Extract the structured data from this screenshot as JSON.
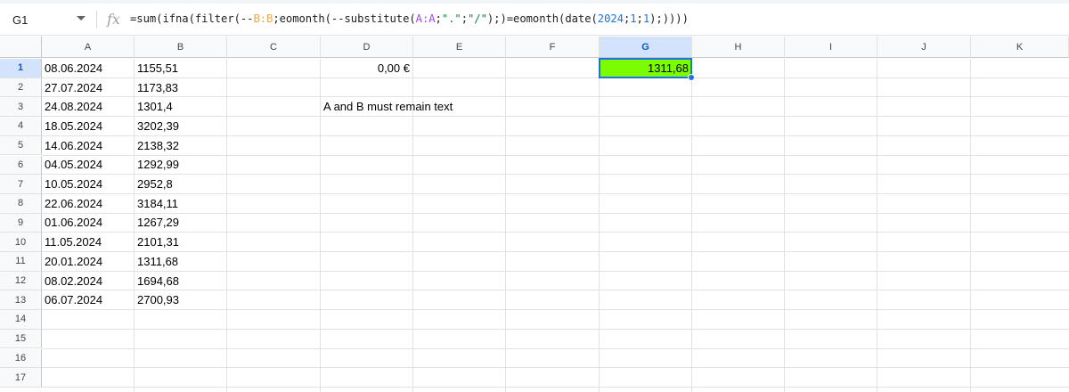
{
  "formula_bar": {
    "name_box": "G1",
    "fx_label": "fx",
    "formula_parts": [
      {
        "t": "=sum(ifna(filter(--",
        "c": ""
      },
      {
        "t": "B:B",
        "c": "r1"
      },
      {
        "t": ";eomonth(--substitute(",
        "c": ""
      },
      {
        "t": "A:A",
        "c": "r2"
      },
      {
        "t": ";",
        "c": ""
      },
      {
        "t": "\".\"",
        "c": "s"
      },
      {
        "t": ";",
        "c": ""
      },
      {
        "t": "\"/\"",
        "c": "s"
      },
      {
        "t": ");)=eomonth(date(",
        "c": ""
      },
      {
        "t": "2024",
        "c": "n"
      },
      {
        "t": ";",
        "c": ""
      },
      {
        "t": "1",
        "c": "n"
      },
      {
        "t": ";",
        "c": ""
      },
      {
        "t": "1",
        "c": "n"
      },
      {
        "t": ");))))",
        "c": ""
      }
    ]
  },
  "columns": [
    "A",
    "B",
    "C",
    "D",
    "E",
    "F",
    "G",
    "H",
    "I",
    "J",
    "K"
  ],
  "selected_column": "G",
  "rows": [
    "1",
    "2",
    "3",
    "4",
    "5",
    "6",
    "7",
    "8",
    "9",
    "10",
    "11",
    "12",
    "13",
    "14",
    "15",
    "16",
    "17"
  ],
  "selected_row": "1",
  "column_a": [
    "08.06.2024",
    "27.07.2024",
    "24.08.2024",
    "18.05.2024",
    "14.06.2024",
    "04.05.2024",
    "10.05.2024",
    "22.06.2024",
    "01.06.2024",
    "11.05.2024",
    "20.01.2024",
    "08.02.2024",
    "06.07.2024"
  ],
  "column_b": [
    "1155,51",
    "1173,83",
    "1301,4",
    "3202,39",
    "2138,32",
    "1292,99",
    "2952,8",
    "3184,11",
    "1267,29",
    "2101,31",
    "1311,68",
    "1694,68",
    "2700,93"
  ],
  "cells": {
    "D1": "0,00 €",
    "D3": "A and B must remain text",
    "G1": "1311,68"
  },
  "colors": {
    "accent": "#1a73e8",
    "g1_fill": "#7cfc00",
    "selected_header_fill": "#d3e3fd"
  }
}
